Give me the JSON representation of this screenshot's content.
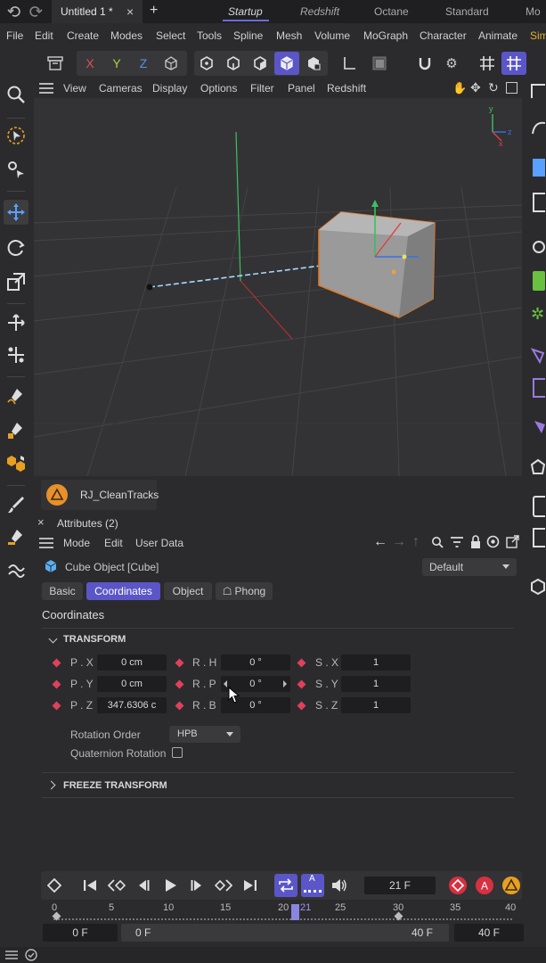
{
  "tabs": {
    "document": "Untitled 1 *",
    "layouts": [
      "Startup",
      "Redshift",
      "Octane",
      "Standard",
      "Mo"
    ]
  },
  "menu": [
    "File",
    "Edit",
    "Create",
    "Modes",
    "Select",
    "Tools",
    "Spline",
    "Mesh",
    "Volume",
    "MoGraph",
    "Character",
    "Animate",
    "Sim"
  ],
  "toolbar": {
    "axis_x": "X",
    "axis_y": "Y",
    "axis_z": "Z",
    "icons": [
      "object-manager-icon",
      "coordinate-system-icon",
      "points-mode-icon",
      "edges-mode-icon",
      "polygons-mode-icon",
      "model-mode-icon",
      "uvw-mode-icon",
      "axis-mode-icon",
      "solo-icon",
      "magnet-icon",
      "settings-icon",
      "grid-snap-icon",
      "snap-icon"
    ]
  },
  "viewport": {
    "menu": [
      "View",
      "Cameras",
      "Display",
      "Options",
      "Filter",
      "Panel",
      "Redshift"
    ],
    "axis_x": "x",
    "axis_y": "y",
    "axis_z": "z"
  },
  "plugin": {
    "label": "RJ_CleanTracks"
  },
  "attributes": {
    "title": "Attributes (2)",
    "menu": [
      "Mode",
      "Edit",
      "User Data"
    ],
    "object_name": "Cube Object [Cube]",
    "preset": "Default",
    "tabs": [
      "Basic",
      "Coordinates",
      "Object",
      "Phong"
    ],
    "section_title": "Coordinates",
    "transform_label": "TRANSFORM",
    "fields": {
      "px_label": "P . X",
      "px_value": "0 cm",
      "py_label": "P . Y",
      "py_value": "0 cm",
      "pz_label": "P . Z",
      "pz_value": "347.6306 c",
      "rh_label": "R . H",
      "rh_value": "0 °",
      "rp_label": "R . P",
      "rp_value": "0 °",
      "rb_label": "R . B",
      "rb_value": "0 °",
      "sx_label": "S . X",
      "sx_value": "1",
      "sy_label": "S . Y",
      "sy_value": "1",
      "sz_label": "S . Z",
      "sz_value": "1"
    },
    "rotation_order_label": "Rotation Order",
    "rotation_order_value": "HPB",
    "quaternion_label": "Quaternion Rotation",
    "freeze_label": "FREEZE TRANSFORM"
  },
  "timeline": {
    "current_frame": "21 F",
    "ruler": [
      "0",
      "5",
      "10",
      "15",
      "20",
      "21",
      "25",
      "30",
      "35",
      "40"
    ],
    "start": "0 F",
    "range_start": "0 F",
    "range_end": "40 F",
    "end": "40 F",
    "autokey_label": "A"
  },
  "colors": {
    "accent": "#5b56c8",
    "keyframe": "#e0405a",
    "orange": "#e8902a",
    "selection": "#e07a2a"
  }
}
